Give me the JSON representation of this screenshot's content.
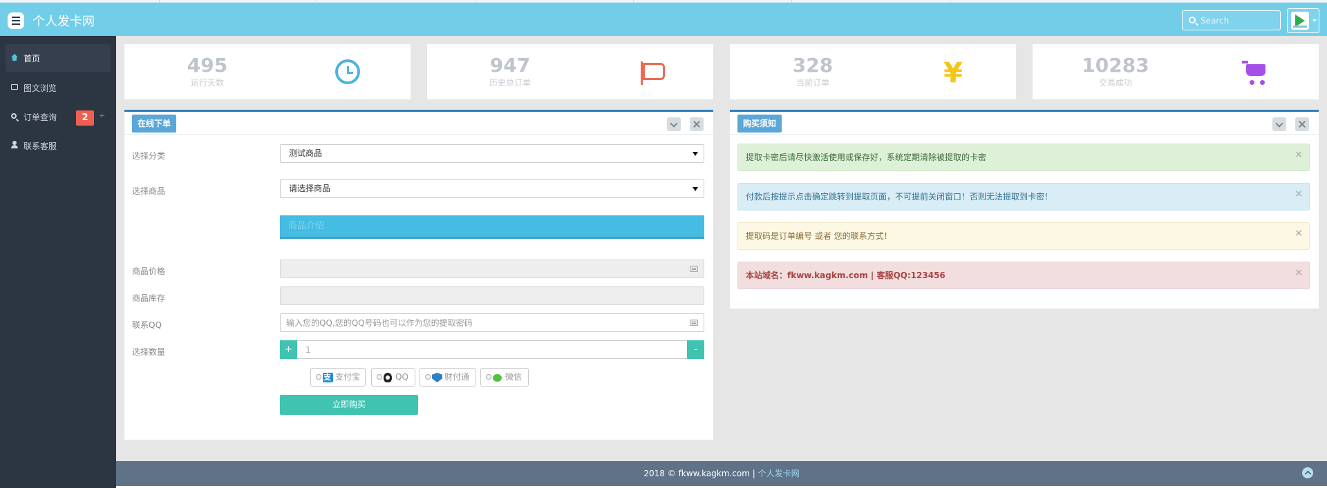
{
  "header": {
    "title": "个人发卡网",
    "search_placeholder": "Search"
  },
  "sidebar": {
    "items": [
      {
        "label": "首页",
        "icon": "home-icon"
      },
      {
        "label": "图文浏览",
        "icon": "image-icon"
      },
      {
        "label": "订单查询",
        "icon": "search-icon",
        "badge": "2",
        "extra": "+"
      },
      {
        "label": "联系客服",
        "icon": "user-icon"
      }
    ]
  },
  "stats": [
    {
      "value": "495",
      "label": "运行天数",
      "icon": "clock-icon",
      "color": "#4fb4d8"
    },
    {
      "value": "947",
      "label": "历史总订单",
      "icon": "flag-icon",
      "color": "#ec6b52"
    },
    {
      "value": "328",
      "label": "当前订单",
      "icon": "yen-icon",
      "glyph": "¥",
      "color": "#f5c518"
    },
    {
      "value": "10283",
      "label": "交易成功",
      "icon": "cart-icon",
      "color": "#a74fe8"
    }
  ],
  "order_panel": {
    "title": "在线下单",
    "category_label": "选择分类",
    "category_value": "测试商品",
    "product_label": "选择商品",
    "product_value": "请选择商品",
    "intro_label": "商品介绍",
    "price_label": "商品价格",
    "stock_label": "商品库存",
    "qq_label": "联系QQ",
    "qq_placeholder": "输入您的QQ,您的QQ号码也可以作为您的提取密码",
    "qty_label": "选择数量",
    "qty_plus": "+",
    "qty_minus": "-",
    "qty_value": "1",
    "payments": [
      {
        "label": "支付宝",
        "icon": "alipay-icon"
      },
      {
        "label": "QQ",
        "icon": "qq-icon"
      },
      {
        "label": "财付通",
        "icon": "tenpay-icon"
      },
      {
        "label": "微信",
        "icon": "wechat-icon"
      }
    ],
    "buy_label": "立即购买"
  },
  "notice_panel": {
    "title": "购买须知",
    "close_glyph": "×",
    "alerts": [
      {
        "text": "提取卡密后请尽快激活使用或保存好，系统定期清除被提取的卡密",
        "type": "success"
      },
      {
        "text": "付款后按提示点击确定跳转到提取页面，不可提前关闭窗口！否则无法提取到卡密！",
        "type": "info"
      },
      {
        "text": "提取码是订单编号 或者 您的联系方式！",
        "type": "warning"
      },
      {
        "text": "本站域名：fkww.kagkm.com | 客服QQ:123456",
        "type": "danger"
      }
    ]
  },
  "footer": {
    "text": "2018 © fkww.kagkm.com | ",
    "link": "个人发卡网"
  }
}
